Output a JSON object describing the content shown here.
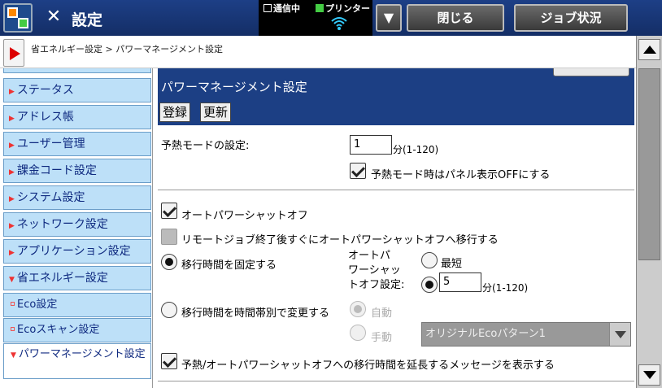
{
  "topbar": {
    "title": "設定",
    "status_comm": "通信中",
    "status_printer": "プリンター",
    "close_label": "閉じる",
    "job_status_label": "ジョブ状況"
  },
  "breadcrumb": "省エネルギー設定 > パワーマネージメント設定",
  "sidebar": {
    "items": [
      {
        "label": "ステータス"
      },
      {
        "label": "アドレス帳"
      },
      {
        "label": "ユーザー管理"
      },
      {
        "label": "課金コード設定"
      },
      {
        "label": "システム設定"
      },
      {
        "label": "ネットワーク設定"
      },
      {
        "label": "アプリケーション設定"
      },
      {
        "label": "省エネルギー設定"
      },
      {
        "label": "Eco設定"
      },
      {
        "label": "Ecoスキャン設定"
      },
      {
        "label": "パワーマネージメント設定"
      }
    ]
  },
  "main": {
    "page_title": "パワーマネージメント設定",
    "save_label": "登録",
    "update_label": "更新",
    "preheat_label": "予熱モードの設定:",
    "preheat_value": "1",
    "preheat_unit": "分(1-120)",
    "preheat_panel_off_label": "予熱モード時はパネル表示OFFにする",
    "auto_power_off_label": "オートパワーシャットオフ",
    "remote_job_label": "リモートジョブ終了後すぐにオートパワーシャットオフへ移行する",
    "fixed_time_label": "移行時間を固定する",
    "apso_setting_label_1": "オートパ",
    "apso_setting_label_2": "ワーシャッ",
    "apso_setting_label_3": "トオフ設定:",
    "shortest_label": "最短",
    "apso_value": "5",
    "apso_unit": "分(1-120)",
    "time_zone_label": "移行時間を時間帯別で変更する",
    "auto_label": "自動",
    "manual_label": "手動",
    "pattern_value": "オリジナルEcoパターン1",
    "extend_msg_label": "予熱/オートパワーシャットオフへの移行時間を延長するメッセージを表示する"
  },
  "colors": {
    "header_blue": "#1c3f84",
    "sidebar_blue": "#bde0f8",
    "accent_red": "#dd0000"
  }
}
